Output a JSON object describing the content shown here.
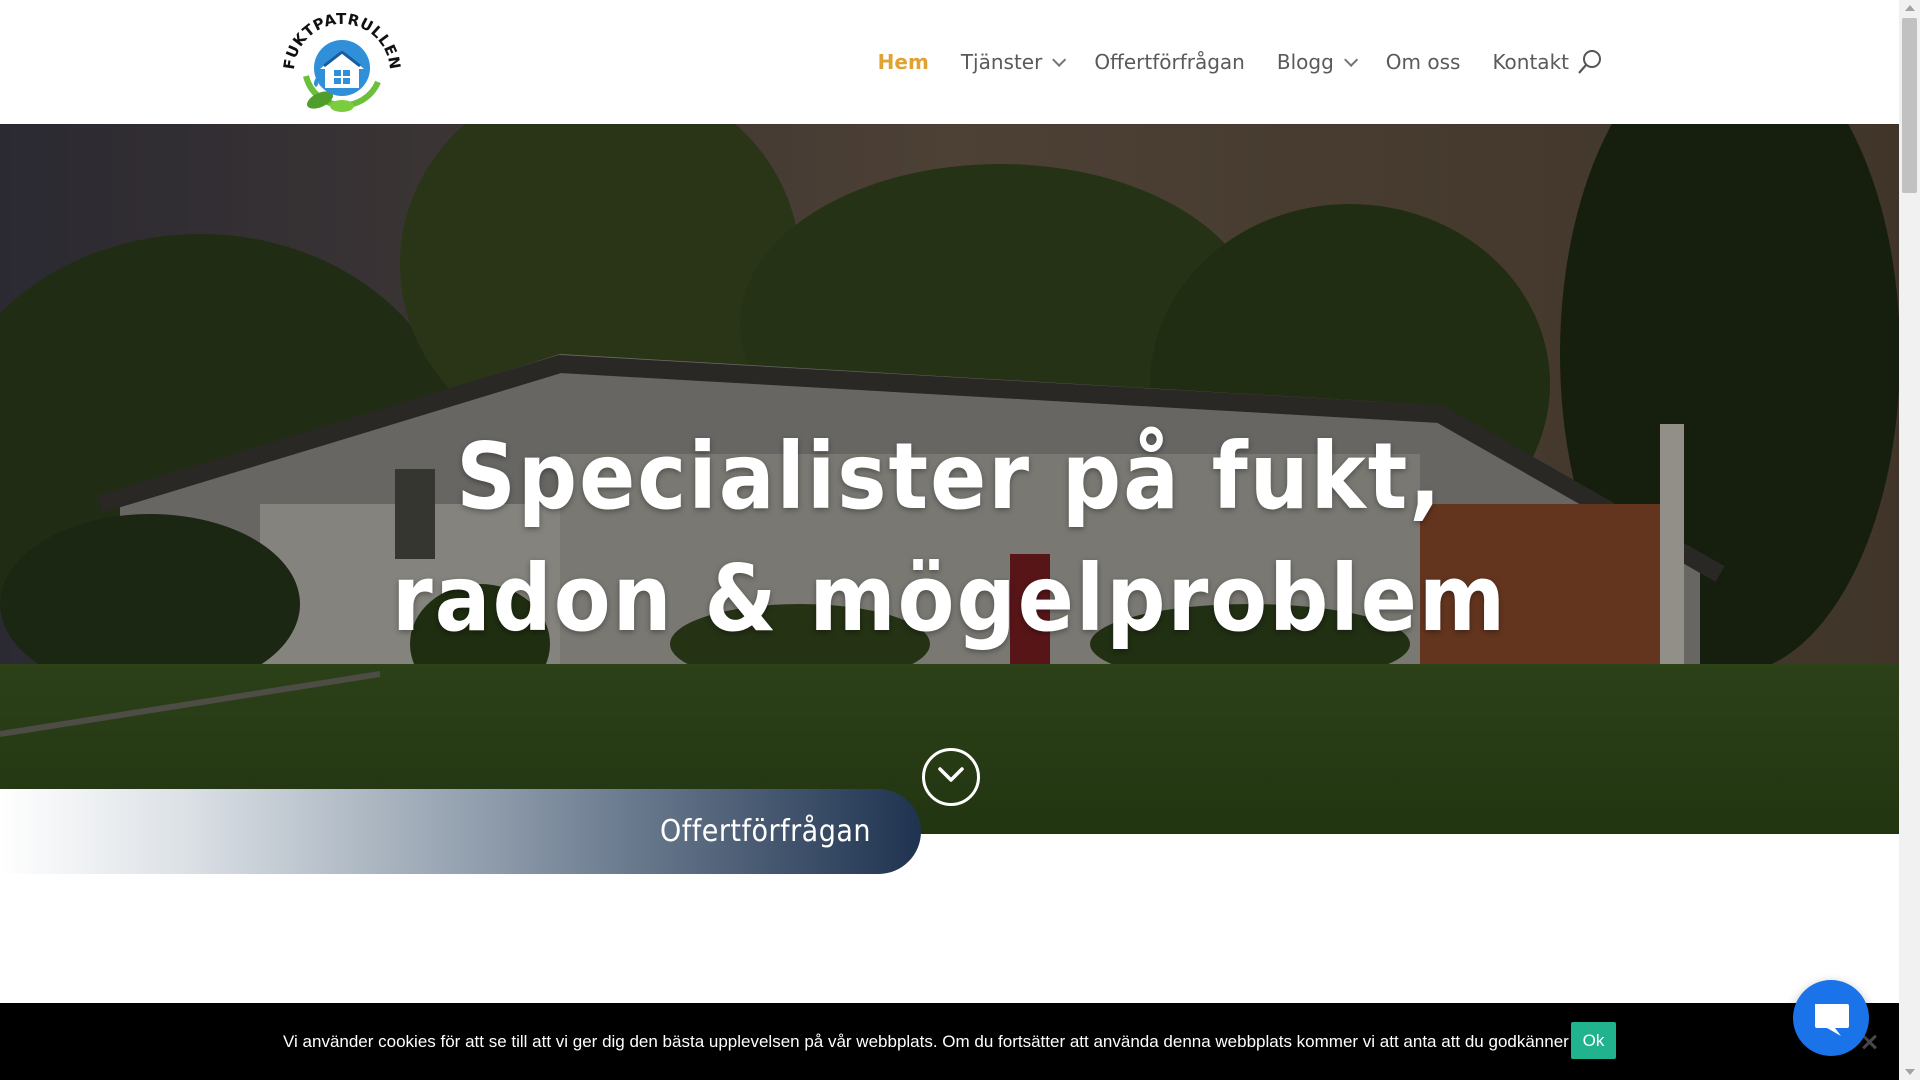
{
  "brand": {
    "logo_text": "FUKTPATRULLEN"
  },
  "nav": {
    "items": [
      {
        "label": "Hem",
        "active": true,
        "has_dropdown": false
      },
      {
        "label": "Tjänster",
        "active": false,
        "has_dropdown": true
      },
      {
        "label": "Offertförfrågan",
        "active": false,
        "has_dropdown": false
      },
      {
        "label": "Blogg",
        "active": false,
        "has_dropdown": true
      },
      {
        "label": "Om oss",
        "active": false,
        "has_dropdown": false
      },
      {
        "label": "Kontakt",
        "active": false,
        "has_dropdown": false
      }
    ],
    "active_color": "#e0a233",
    "search_icon": "search-icon"
  },
  "hero": {
    "title_line1": "Specialister på fukt,",
    "title_line2": "radon & mögelproblem",
    "scroll_icon": "chevron-down-circle-icon"
  },
  "quote_banner": {
    "label": "Offertförfrågan",
    "accent": "#1f3350"
  },
  "cookie": {
    "text": "Vi använder cookies för att se till att vi ger dig den bästa upplevelsen på vår webbplats. Om du fortsätter att använda denna webbplats kommer vi att anta att du godkänner detta.",
    "ok_label": "Ok",
    "ok_color": "#21b28e",
    "close_icon": "close-icon"
  },
  "chat": {
    "icon": "chat-bubble-icon",
    "color": "#1a73e8"
  }
}
